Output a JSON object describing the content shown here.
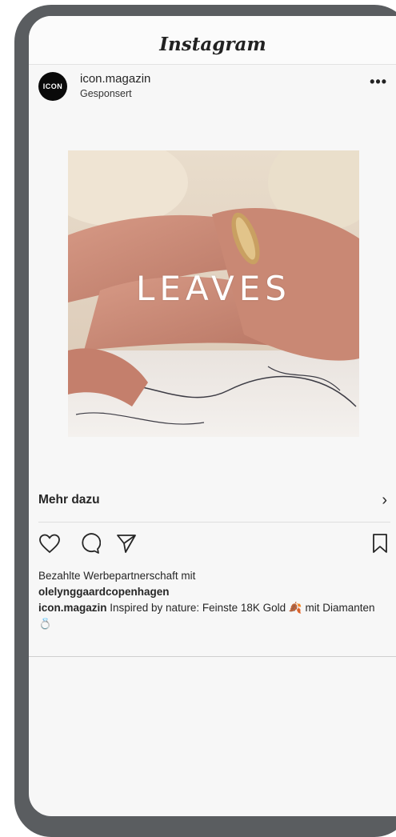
{
  "app": {
    "name": "Instagram"
  },
  "post": {
    "avatar_text": "ICON",
    "username": "icon.magazin",
    "sponsored_label": "Gesponsert",
    "more_label": "•••",
    "media_title": "LEAVES",
    "cta_label": "Mehr dazu",
    "cta_chevron": "›",
    "paid_partnership": "Bezahlte Werbepartnerschaft mit",
    "partner": "olelynggaardcopenhagen",
    "caption_user": "icon.magazin",
    "caption_text": " Inspired by nature: Feinste 18K Gold 🍂 mit Diamanten 💍"
  },
  "icons": [
    "heart-icon",
    "comment-icon",
    "share-icon",
    "bookmark-icon"
  ]
}
